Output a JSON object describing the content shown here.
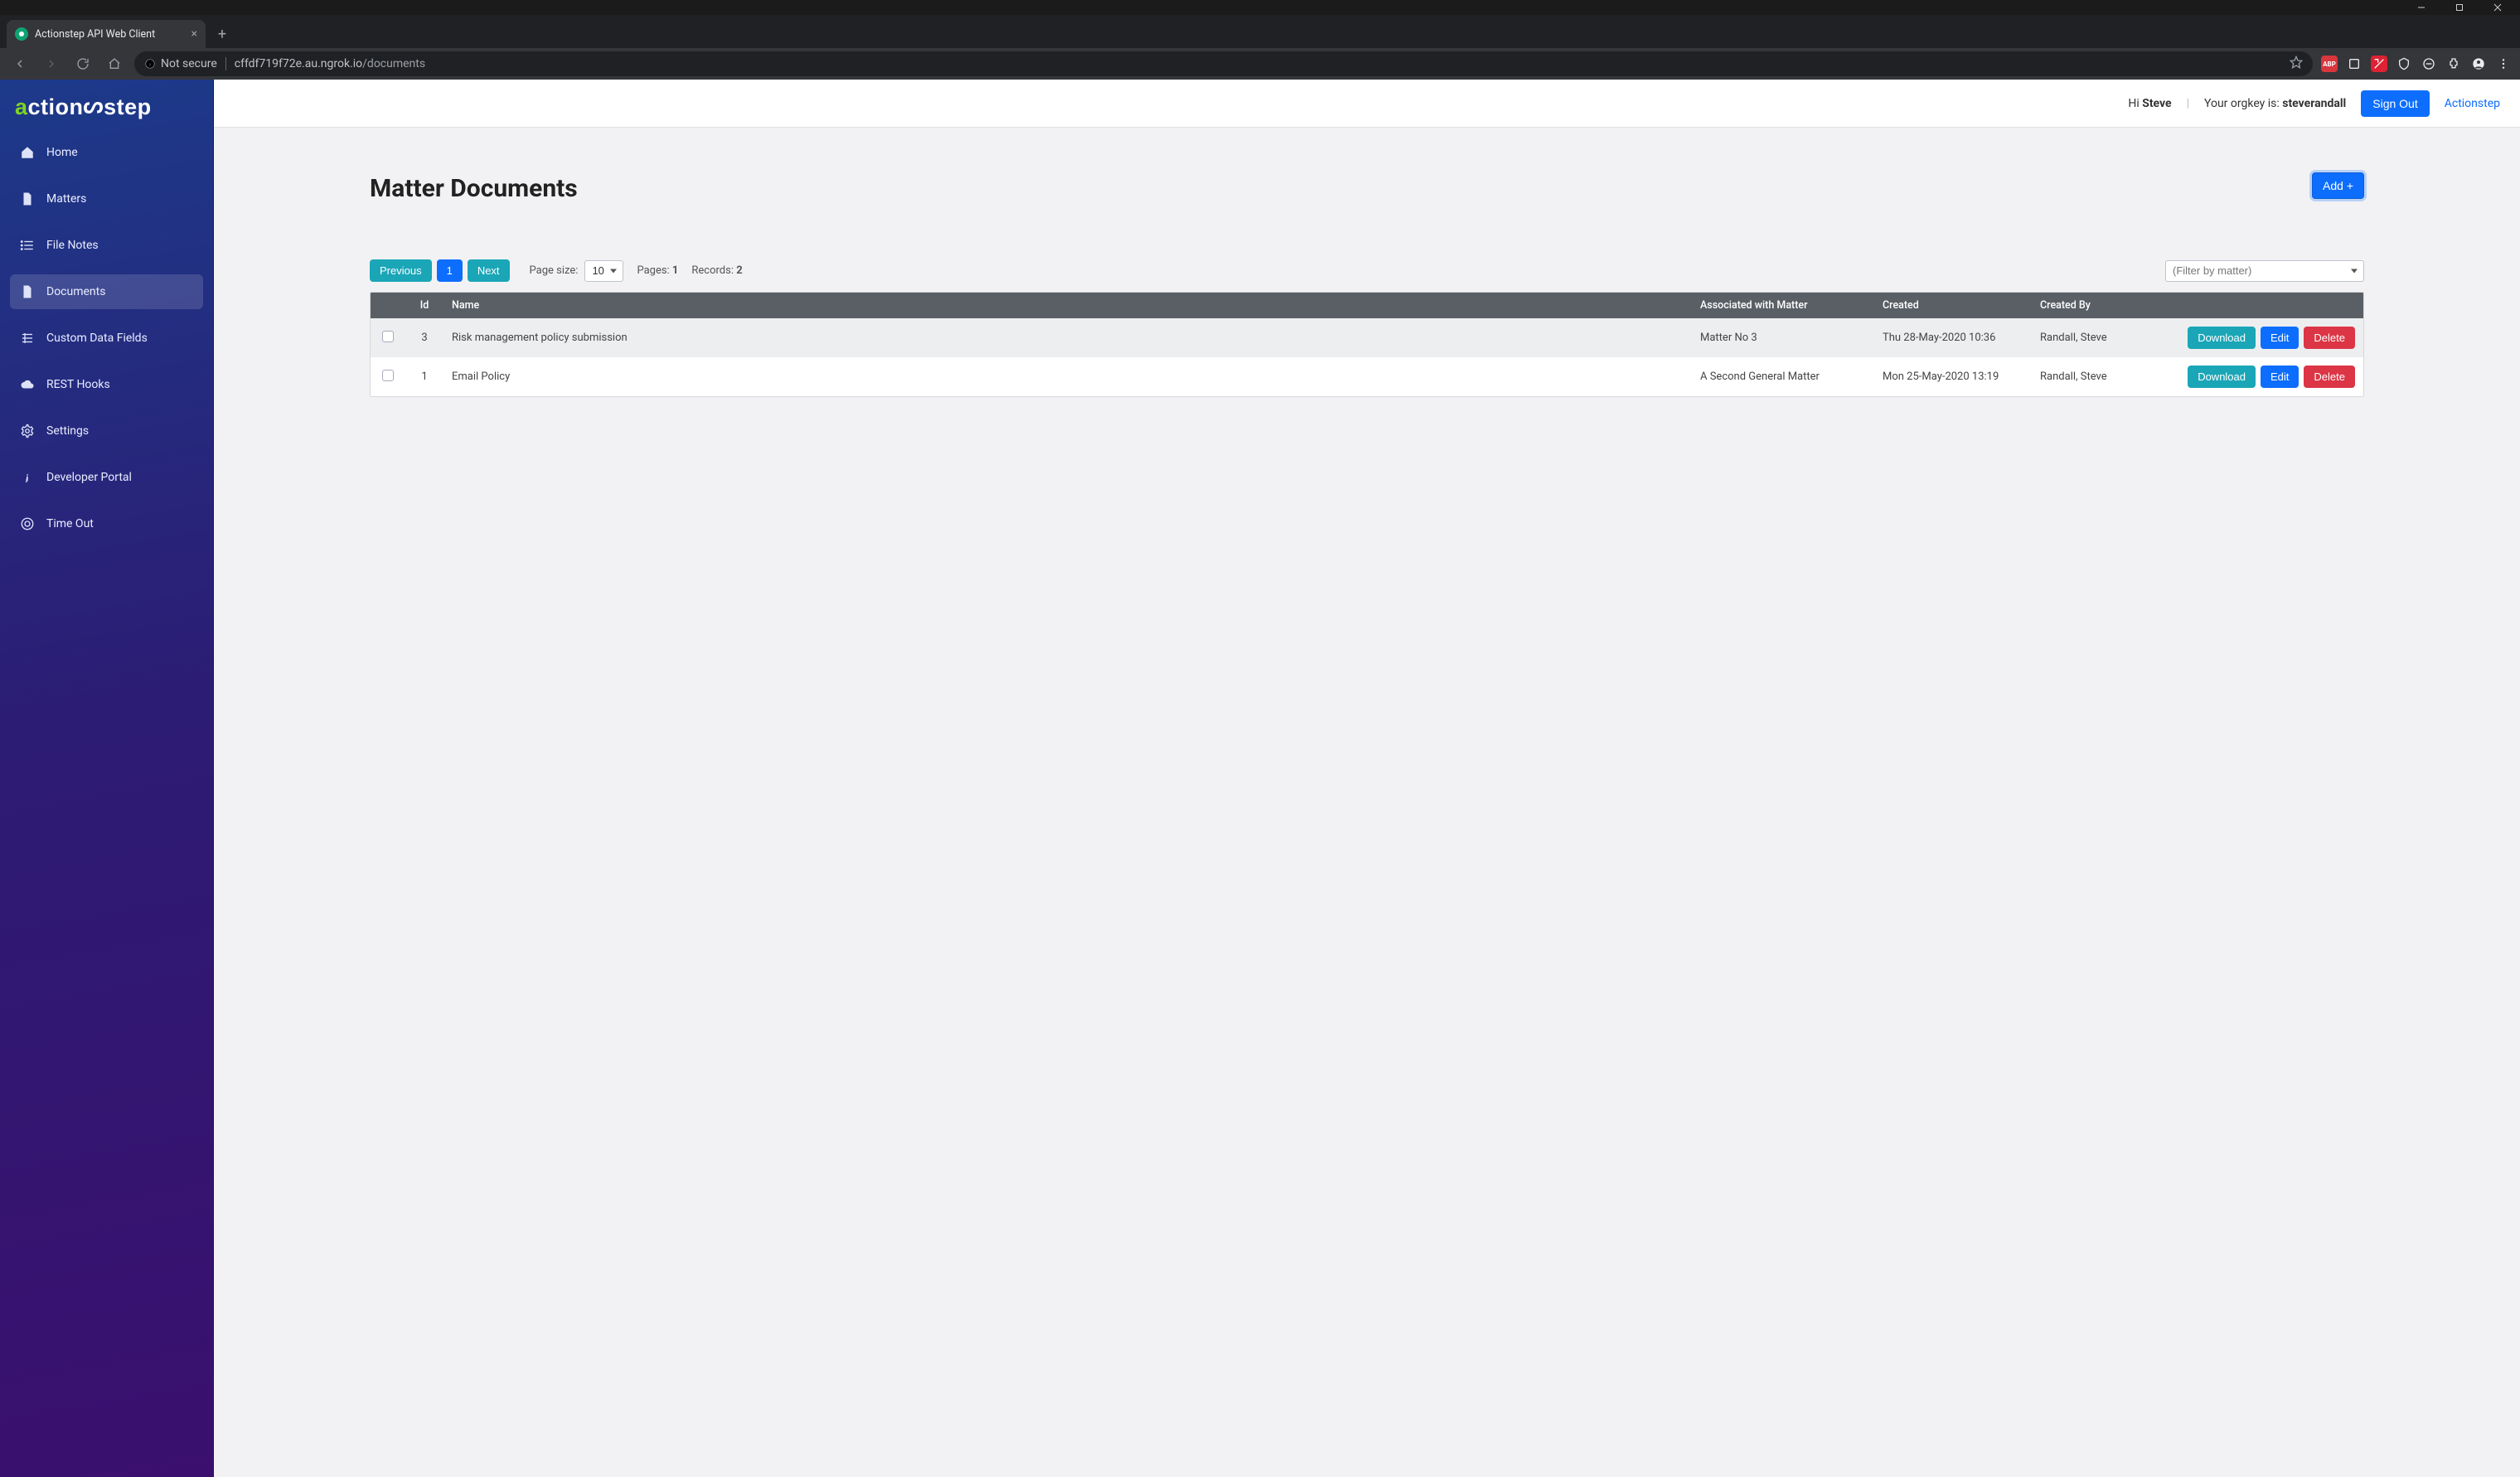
{
  "browser": {
    "tab_title": "Actionstep API Web Client",
    "url_host": "cffdf719f72e.au.ngrok.io",
    "url_path": "/documents",
    "security_label": "Not secure",
    "ext_abp": "ABP"
  },
  "logo": {
    "a": "a",
    "ction": "ction",
    "step": "step"
  },
  "sidebar": {
    "items": [
      {
        "label": "Home",
        "active": false
      },
      {
        "label": "Matters",
        "active": false
      },
      {
        "label": "File Notes",
        "active": false
      },
      {
        "label": "Documents",
        "active": true
      },
      {
        "label": "Custom Data Fields",
        "active": false
      },
      {
        "label": "REST Hooks",
        "active": false
      },
      {
        "label": "Settings",
        "active": false
      },
      {
        "label": "Developer Portal",
        "active": false
      },
      {
        "label": "Time Out",
        "active": false
      }
    ]
  },
  "topbar": {
    "hi": "Hi ",
    "user": "Steve",
    "orgkey_prefix": "Your orgkey is: ",
    "orgkey": "steverandall",
    "sign_out": "Sign Out",
    "brand_link": "Actionstep"
  },
  "page": {
    "title": "Matter Documents",
    "add_label": "Add +"
  },
  "pager": {
    "previous": "Previous",
    "page1": "1",
    "next": "Next",
    "page_size_label": "Page size:",
    "page_size_value": "10",
    "pages_label": "Pages: ",
    "pages_value": "1",
    "records_label": "Records: ",
    "records_value": "2",
    "filter_placeholder": "(Filter by matter)"
  },
  "table": {
    "headers": {
      "id": "Id",
      "name": "Name",
      "matter": "Associated with Matter",
      "created": "Created",
      "created_by": "Created By"
    },
    "actions": {
      "download": "Download",
      "edit": "Edit",
      "delete": "Delete"
    },
    "rows": [
      {
        "id": "3",
        "name": "Risk management policy submission",
        "matter": "Matter No 3",
        "created": "Thu 28-May-2020 10:36",
        "created_by": "Randall, Steve"
      },
      {
        "id": "1",
        "name": "Email Policy",
        "matter": "A Second General Matter",
        "created": "Mon 25-May-2020 13:19",
        "created_by": "Randall, Steve"
      }
    ]
  }
}
